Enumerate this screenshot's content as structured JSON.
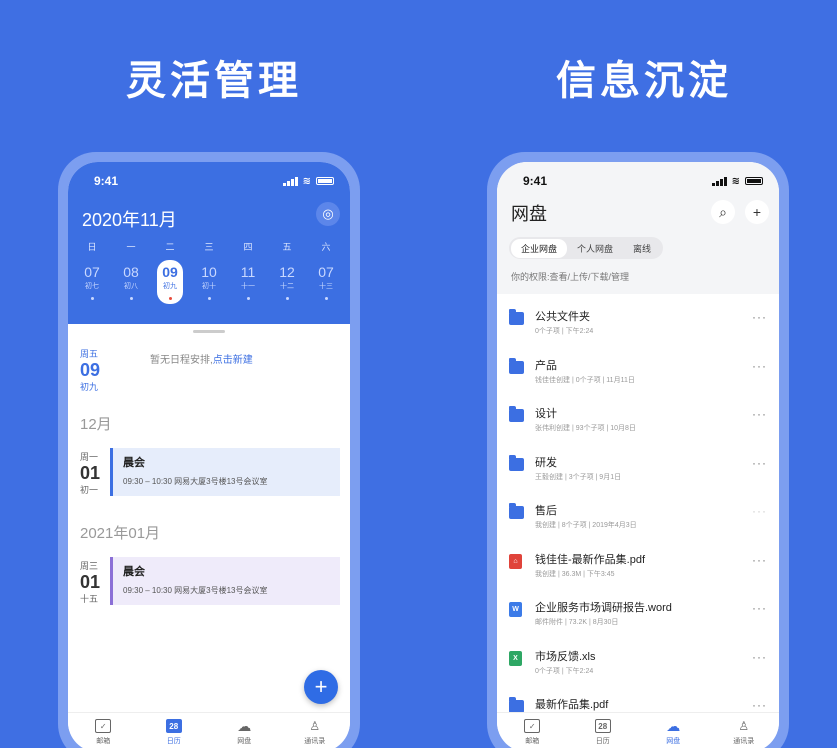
{
  "headlines": {
    "left": "灵活管理",
    "right": "信息沉淀"
  },
  "status": {
    "time": "9:41"
  },
  "calendar": {
    "month_title": "2020年11月",
    "weekdays": [
      "日",
      "一",
      "二",
      "三",
      "四",
      "五",
      "六"
    ],
    "days": [
      {
        "num": "07",
        "lunar": "初七",
        "dot": true
      },
      {
        "num": "08",
        "lunar": "初八",
        "dot": true
      },
      {
        "num": "09",
        "lunar": "初九",
        "dot": true,
        "selected": true
      },
      {
        "num": "10",
        "lunar": "初十",
        "dot": true
      },
      {
        "num": "11",
        "lunar": "十一",
        "dot": true
      },
      {
        "num": "12",
        "lunar": "十二",
        "dot": true
      },
      {
        "num": "07",
        "lunar": "十三",
        "dot": true
      }
    ],
    "today": {
      "weekday": "周五",
      "day": "09",
      "lunar": "初九",
      "empty_text": "暂无日程安排,",
      "create_link": "点击新建"
    },
    "sections": [
      {
        "month": "12月",
        "weekday": "周一",
        "day": "01",
        "lunar": "初一",
        "event_title": "晨会",
        "event_detail": "09:30 – 10:30  网易大厦3号楼13号会议室"
      },
      {
        "month": "2021年01月",
        "weekday": "周三",
        "day": "01",
        "lunar": "十五",
        "event_title": "晨会",
        "event_detail": "09:30 – 10:30  网易大厦3号楼13号会议室"
      }
    ],
    "fab": "+",
    "target_icon": "◎"
  },
  "tabs": [
    {
      "label": "邮箱",
      "icon": "mail-icon"
    },
    {
      "label": "日历",
      "icon": "calendar-icon",
      "badge": "28"
    },
    {
      "label": "网盘",
      "icon": "cloud-icon"
    },
    {
      "label": "通讯录",
      "icon": "contacts-icon"
    }
  ],
  "drive": {
    "title": "网盘",
    "search_icon": "⌕",
    "add_icon": "+",
    "segments": [
      "企业网盘",
      "个人网盘",
      "离线"
    ],
    "permission": "你的权限:查看/上传/下载/管理",
    "files": [
      {
        "name": "公共文件夹",
        "meta": "0个子项 | 下午2:24",
        "type": "folder"
      },
      {
        "name": "产品",
        "meta": "钱佳佳创建 | 0个子项 | 11月11日",
        "type": "folder"
      },
      {
        "name": "设计",
        "meta": "张伟利创建 | 93个子项 | 10月8日",
        "type": "folder"
      },
      {
        "name": "研发",
        "meta": "王毅创建 | 3个子项 | 9月1日",
        "type": "folder"
      },
      {
        "name": "售后",
        "meta": "我创建 | 8个子项 | 2019年4月3日",
        "type": "folder"
      },
      {
        "name": "钱佳佳-最新作品集.pdf",
        "meta": "我创建 | 36.3M | 下午3:45",
        "type": "pdf"
      },
      {
        "name": "企业服务市场调研报告.word",
        "meta": "邮件附件 | 73.2K | 8月30日",
        "type": "word"
      },
      {
        "name": "市场反馈.xls",
        "meta": "0个子项 | 下午2:24",
        "type": "xls"
      },
      {
        "name": "最新作品集.pdf",
        "meta": "",
        "type": "folder"
      }
    ],
    "more_icon": "···"
  },
  "colors": {
    "background": "#3f6fe3",
    "accent": "#3c6fe2",
    "pdf": "#e0433a",
    "word": "#3c7be8",
    "xls": "#2ea764"
  }
}
